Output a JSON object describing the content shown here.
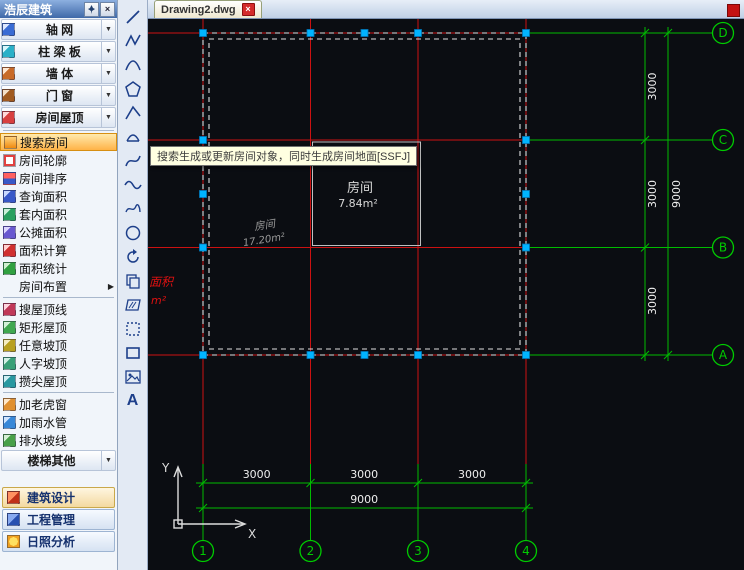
{
  "window": {
    "panel_title": "浩辰建筑"
  },
  "tabbar": {
    "active_tab": "Drawing2.dwg"
  },
  "tooltip": {
    "text": "搜索生成或更新房间对象，同时生成房间地面[SSFJ]"
  },
  "sidebar": {
    "dropdown_items": [
      {
        "label": "轴  网"
      },
      {
        "label": "柱 梁 板"
      },
      {
        "label": "墙  体"
      },
      {
        "label": "门  窗"
      },
      {
        "label": "房间屋顶"
      }
    ],
    "commands": [
      {
        "label": "搜索房间"
      },
      {
        "label": "房间轮廓"
      },
      {
        "label": "房间排序"
      },
      {
        "label": "查询面积"
      },
      {
        "label": "套内面积"
      },
      {
        "label": "公摊面积"
      },
      {
        "label": "面积计算"
      },
      {
        "label": "面积统计"
      },
      {
        "label": "房间布置"
      },
      {
        "label": "搜屋顶线"
      },
      {
        "label": "矩形屋顶"
      },
      {
        "label": "任意坡顶"
      },
      {
        "label": "人字坡顶"
      },
      {
        "label": "攒尖屋顶"
      },
      {
        "label": "加老虎窗"
      },
      {
        "label": "加雨水管"
      },
      {
        "label": "排水坡线"
      },
      {
        "label": "楼梯其他"
      }
    ],
    "modes": [
      {
        "label": "建筑设计"
      },
      {
        "label": "工程管理"
      },
      {
        "label": "日照分析"
      }
    ]
  },
  "toolbar": {
    "text_tool": "A"
  },
  "drawing": {
    "axis_letters": [
      "D",
      "C",
      "B",
      "A"
    ],
    "axis_numbers": [
      "1",
      "2",
      "3",
      "4"
    ],
    "bottom_dims": [
      "3000",
      "3000",
      "3000"
    ],
    "bottom_total": "9000",
    "right_dims": [
      "3000",
      "3000",
      "3000"
    ],
    "right_total": "9000",
    "room1": {
      "name": "房间",
      "area": "7.84m²"
    },
    "room2": {
      "name": "房间",
      "area": "17.20m²"
    },
    "red_text": {
      "line1": "面积",
      "line2": "m²"
    },
    "ucs": {
      "x": "X",
      "y": "Y"
    }
  }
}
